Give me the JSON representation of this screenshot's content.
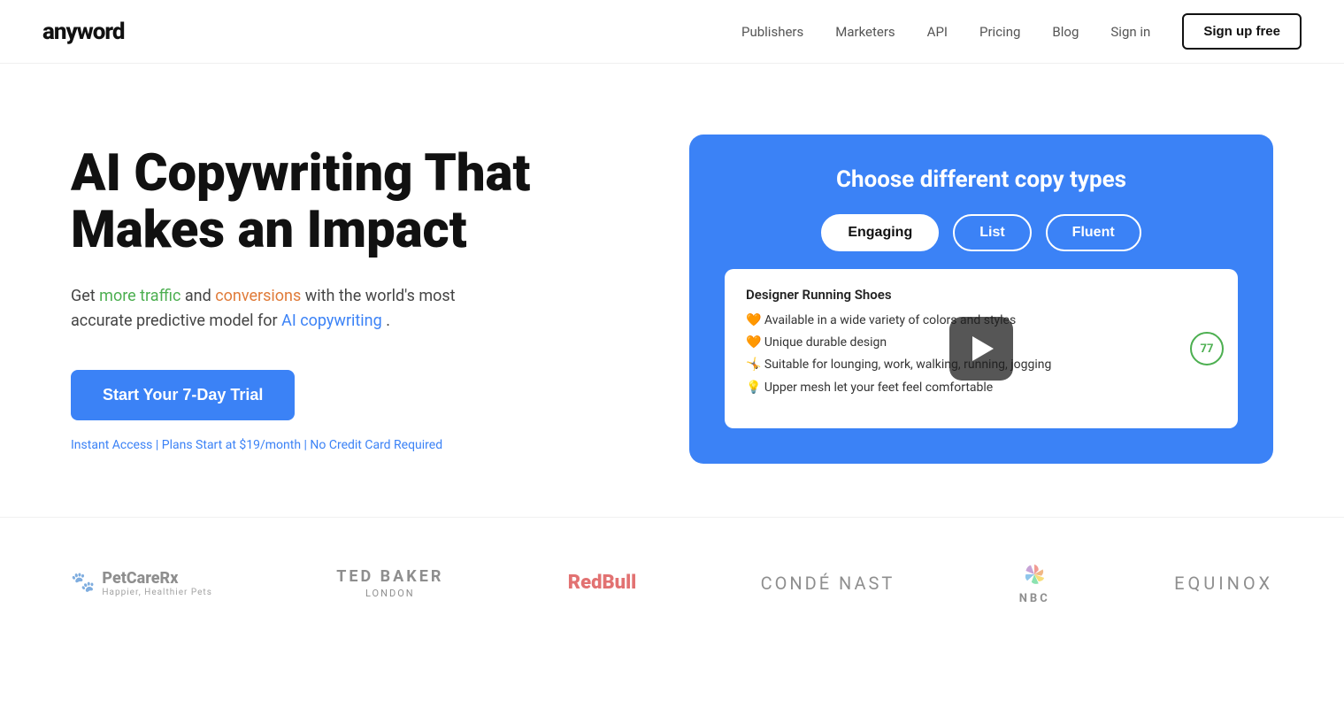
{
  "nav": {
    "logo": "anyword",
    "links": [
      {
        "label": "Publishers",
        "id": "publishers"
      },
      {
        "label": "Marketers",
        "id": "marketers"
      },
      {
        "label": "API",
        "id": "api"
      },
      {
        "label": "Pricing",
        "id": "pricing"
      },
      {
        "label": "Blog",
        "id": "blog"
      }
    ],
    "signin_label": "Sign in",
    "signup_label": "Sign up free"
  },
  "hero": {
    "title": "AI Copywriting That Makes an Impact",
    "subtitle_part1": "Get ",
    "subtitle_green": "more traffic",
    "subtitle_part2": " and ",
    "subtitle_orange": "conversions",
    "subtitle_part3": " with the world's most accurate predictive model for ",
    "subtitle_blue": "AI copywriting",
    "subtitle_end": ".",
    "cta_label": "Start Your 7-Day Trial",
    "subtext": "Instant Access | Plans Start at $19/month | No Credit Card Required"
  },
  "video_panel": {
    "title": "Choose different copy types",
    "buttons": [
      {
        "label": "Engaging",
        "active": true
      },
      {
        "label": "List",
        "active": false
      },
      {
        "label": "Fluent",
        "active": false
      }
    ],
    "product_title": "Designer Running Shoes",
    "bullets": [
      "🧡 Available in a wide variety of colors and styles",
      "🧡 Unique durable design",
      "🤸 Suitable for lounging, work, walking, running, jogging",
      "💡 Upper mesh let your feet feel comfortable"
    ],
    "score": "77"
  },
  "logos": [
    {
      "id": "petcare",
      "type": "petcare",
      "name": "PetCareRx",
      "sub": "Happier, Healthier Pets"
    },
    {
      "id": "tedbaker",
      "type": "text",
      "main": "TED BAKER",
      "sub": "LONDON"
    },
    {
      "id": "redbull",
      "type": "redbull",
      "text": "RedBull"
    },
    {
      "id": "condenast",
      "type": "text",
      "main": "CONDÉ NAST",
      "sub": ""
    },
    {
      "id": "nbc",
      "type": "nbc",
      "label": "NBC"
    },
    {
      "id": "equinox",
      "type": "text",
      "main": "EQUINOX",
      "sub": ""
    }
  ]
}
